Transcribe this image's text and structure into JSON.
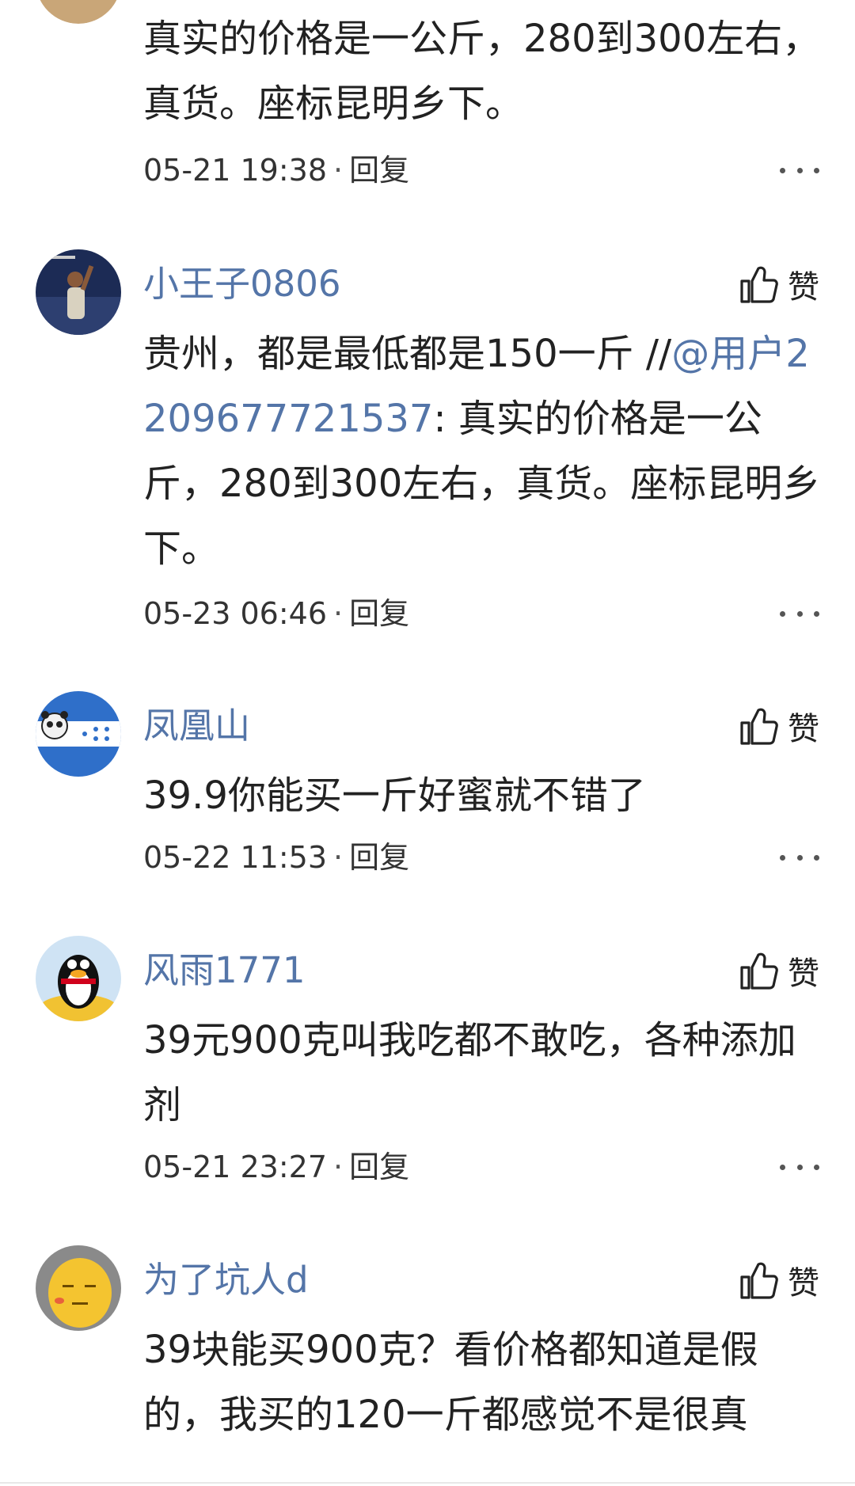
{
  "comments": [
    {
      "text": "真实的价格是一公斤，280到300左右，真货。座标昆明乡下。",
      "time": "05-21 19:38",
      "reply": "回复"
    },
    {
      "username": "小王子0806",
      "like": "赞",
      "text_prefix": "贵州，都是最低都是150一斤 //",
      "mention": "@用户2209677721537",
      "text_suffix": ": 真实的价格是一公斤，280到300左右，真货。座标昆明乡下。",
      "time": "05-23 06:46",
      "reply": "回复"
    },
    {
      "username": "凤凰山",
      "like": "赞",
      "text": "39.9你能买一斤好蜜就不错了",
      "time": "05-22 11:53",
      "reply": "回复"
    },
    {
      "username": "风雨1771",
      "like": "赞",
      "text": "39元900克叫我吃都不敢吃，各种添加剂",
      "time": "05-21 23:27",
      "reply": "回复"
    },
    {
      "username": "为了坑人d",
      "like": "赞",
      "text": "39块能买900克？看价格都知道是假的，我买的120一斤都感觉不是很真"
    }
  ],
  "separator": "·",
  "icons": {
    "like": "thumbs-up-icon",
    "more": "more-dots-icon"
  },
  "colors": {
    "username": "#5475a8",
    "text": "#222222",
    "meta": "#333333"
  }
}
